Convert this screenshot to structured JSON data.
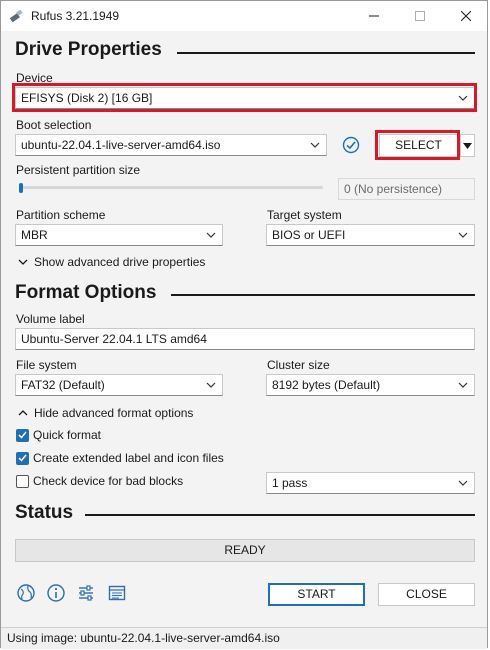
{
  "window": {
    "title": "Rufus 3.21.1949"
  },
  "sections": {
    "drive_properties": "Drive Properties",
    "format_options": "Format Options",
    "status": "Status"
  },
  "device": {
    "label": "Device",
    "value": "EFISYS (Disk 2) [16 GB]"
  },
  "boot_selection": {
    "label": "Boot selection",
    "value": "ubuntu-22.04.1-live-server-amd64.iso",
    "select_button": "SELECT"
  },
  "persistent_partition": {
    "label": "Persistent partition size",
    "value": "0 (No persistence)",
    "slider_fraction": 0.0
  },
  "partition_scheme": {
    "label": "Partition scheme",
    "value": "MBR"
  },
  "target_system": {
    "label": "Target system",
    "value": "BIOS or UEFI"
  },
  "advanced_drive": {
    "label": "Show advanced drive properties"
  },
  "volume_label": {
    "label": "Volume label",
    "value": "Ubuntu-Server 22.04.1 LTS amd64"
  },
  "file_system": {
    "label": "File system",
    "value": "FAT32 (Default)"
  },
  "cluster_size": {
    "label": "Cluster size",
    "value": "8192 bytes (Default)"
  },
  "advanced_format": {
    "label": "Hide advanced format options"
  },
  "checkboxes": {
    "quick_format": {
      "label": "Quick format",
      "checked": true
    },
    "extended_label": {
      "label": "Create extended label and icon files",
      "checked": true
    },
    "bad_blocks": {
      "label": "Check device for bad blocks",
      "checked": false
    }
  },
  "passes": {
    "value": "1 pass"
  },
  "status_bar": {
    "text": "READY"
  },
  "buttons": {
    "start": "START",
    "close": "CLOSE"
  },
  "toolbar_icons": [
    "globe-icon",
    "info-icon",
    "settings-sliders-icon",
    "log-icon"
  ],
  "footer": {
    "text": "Using image: ubuntu-22.04.1-live-server-amd64.iso"
  },
  "colors": {
    "highlight": "#d41b2c",
    "accent": "#1f6fb5"
  }
}
